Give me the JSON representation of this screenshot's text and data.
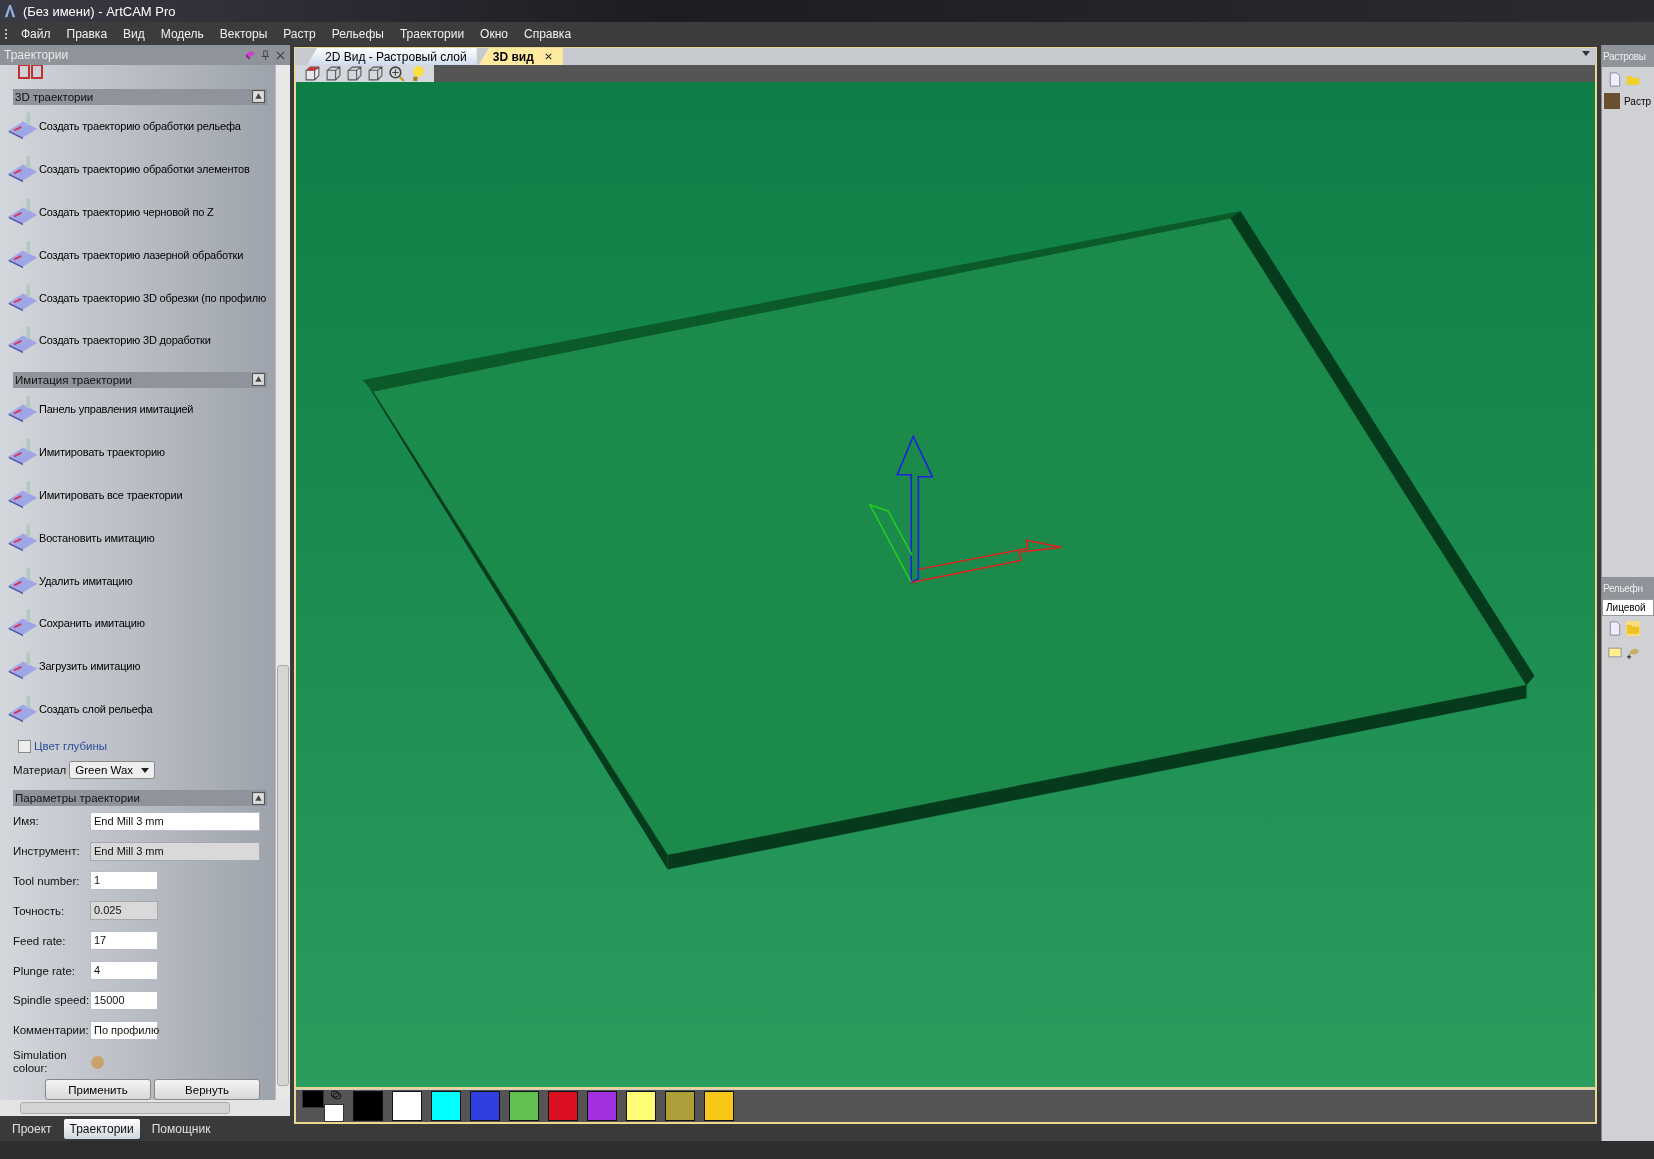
{
  "window": {
    "title": "(Без имени) - ArtCAM Pro"
  },
  "menu": [
    "Файл",
    "Правка",
    "Вид",
    "Модель",
    "Векторы",
    "Растр",
    "Рельефы",
    "Траектории",
    "Окно",
    "Справка"
  ],
  "left_panel": {
    "title": "Траектории",
    "sections": [
      {
        "title": "3D траектории",
        "expanded": true,
        "items": [
          "Создать траекторию обработки рельефа",
          "Создать траекторию обработки элементов",
          "Создать траекторию черновой по Z",
          "Создать траекторию лазерной обработки",
          "Создать траекторию 3D обрезки (по профилю",
          "Создать траекторию 3D доработки"
        ]
      },
      {
        "title": "Имитация траектории",
        "expanded": true,
        "items": [
          "Панель управления имитацией",
          "Имитировать траекторию",
          "Имитировать все траектории",
          "Востановить имитацию",
          "Удалить имитацию",
          "Сохранить имитацию",
          "Загрузить имитацию",
          "Создать слой рельефа"
        ]
      }
    ],
    "depth_color": {
      "label": "Цвет глубины",
      "checked": false
    },
    "material": {
      "label": "Материал",
      "value": "Green Wax"
    },
    "params": {
      "title": "Параметры траектории",
      "fields": [
        {
          "label": "Имя:",
          "value": "End Mill 3 mm",
          "wide": true,
          "disabled": false
        },
        {
          "label": "Инструмент:",
          "value": "End Mill 3 mm",
          "wide": true,
          "disabled": true
        },
        {
          "label": "Tool number:",
          "value": "1",
          "wide": false,
          "disabled": false
        },
        {
          "label": "Точность:",
          "value": "0.025",
          "wide": false,
          "disabled": true
        },
        {
          "label": "Feed rate:",
          "value": "17",
          "wide": false,
          "disabled": false
        },
        {
          "label": "Plunge rate:",
          "value": "4",
          "wide": false,
          "disabled": false
        },
        {
          "label": "Spindle speed:",
          "value": "15000",
          "wide": false,
          "disabled": false
        },
        {
          "label": "Комментарии:",
          "value": "По профилю",
          "wide": false,
          "disabled": false
        }
      ],
      "simulation_colour": {
        "label": "Simulation colour:",
        "color": "#c8a46a"
      },
      "buttons": [
        "Применить",
        "Вернуть"
      ]
    },
    "bottom_tabs": [
      {
        "label": "Проект",
        "selected": false
      },
      {
        "label": "Траектории",
        "selected": true
      },
      {
        "label": "Помощник",
        "selected": false
      }
    ]
  },
  "doc_tabs": [
    {
      "label": "2D Вид - Растровый слой",
      "selected": false
    },
    {
      "label": "3D вид",
      "selected": true
    }
  ],
  "palette": {
    "swatches": [
      {
        "color": "#000000"
      },
      {
        "color": "#ffffff"
      },
      {
        "color": "#00ffff"
      },
      {
        "color": "#3040e0"
      },
      {
        "color": "#60c050"
      },
      {
        "color": "#d81020"
      },
      {
        "color": "#a030e0"
      },
      {
        "color": "#fffc78"
      },
      {
        "color": "#ada038"
      },
      {
        "color": "#f8c818"
      }
    ]
  },
  "right_panel": {
    "raster_title": "Растровы",
    "raster_item": "Растр",
    "relief_title": "Рельефн",
    "relief_select": "Лицевой"
  }
}
